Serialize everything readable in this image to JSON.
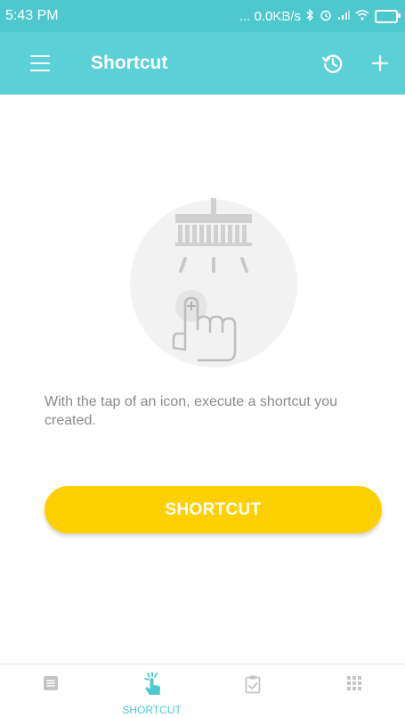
{
  "status_bar": {
    "time": "5:43 PM",
    "network": "... 0.0KB/s",
    "icons": [
      "bluetooth-icon",
      "alarm-icon",
      "signal-icon",
      "wifi-icon",
      "battery-icon"
    ]
  },
  "toolbar": {
    "title": "Shortcut",
    "icons": [
      "menu-icon",
      "history-icon",
      "add-icon"
    ]
  },
  "main": {
    "empty_message": "With the tap of an icon, execute a shortcut you created.",
    "button_label": "SHORTCUT",
    "illustration": "tap-shortcut-illustration"
  },
  "bottom_nav": {
    "items": [
      {
        "icon": "document-icon",
        "label": ""
      },
      {
        "icon": "shortcut-tap-icon",
        "label": "SHORTCUT"
      },
      {
        "icon": "clipboard-check-icon",
        "label": ""
      },
      {
        "icon": "grid-icon",
        "label": ""
      }
    ],
    "active_index": 1
  },
  "colors": {
    "status_bar": "#4ec8cf",
    "toolbar": "#5bd0d7",
    "accent_button": "#ffd000",
    "text_muted": "#8a8a8a"
  }
}
